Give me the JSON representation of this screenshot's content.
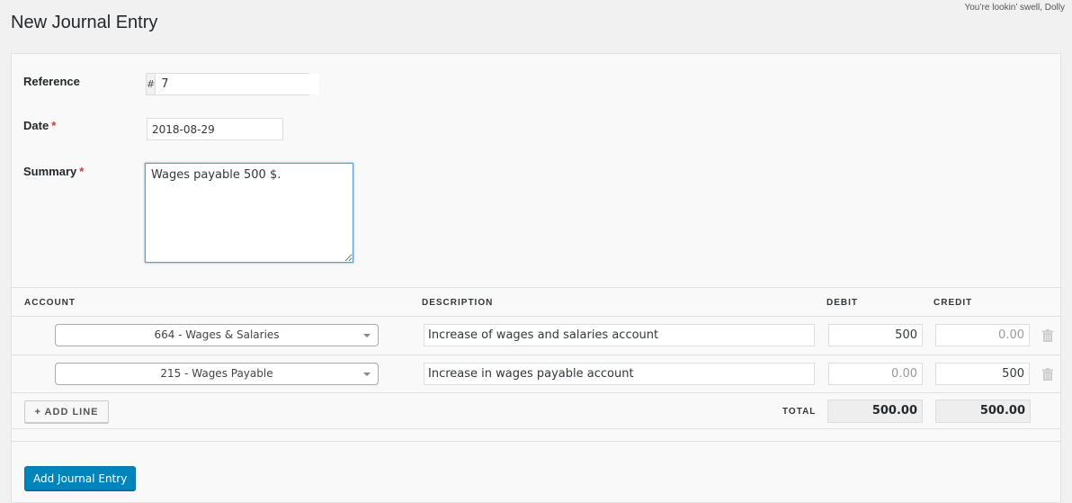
{
  "header": {
    "title": "New Journal Entry",
    "dolly_text": "You’re lookin’ swell, Dolly"
  },
  "form": {
    "reference": {
      "label": "Reference",
      "prefix": "#",
      "value": "7"
    },
    "date": {
      "label": "Date",
      "required_mark": "*",
      "value": "2018-08-29"
    },
    "summary": {
      "label": "Summary",
      "required_mark": "*",
      "value": "Wages payable 500 $."
    }
  },
  "table": {
    "headers": {
      "account": "ACCOUNT",
      "description": "DESCRIPTION",
      "debit": "DEBIT",
      "credit": "CREDIT"
    },
    "rows": [
      {
        "account": "664 - Wages & Salaries",
        "description": "Increase of wages and salaries account",
        "debit": "500",
        "credit": "",
        "debit_placeholder": "0.00",
        "credit_placeholder": "0.00"
      },
      {
        "account": "215 - Wages Payable",
        "description": "Increase in wages payable account",
        "debit": "",
        "credit": "500",
        "debit_placeholder": "0.00",
        "credit_placeholder": "0.00"
      }
    ],
    "add_line_label": "+ ADD LINE",
    "total_label": "TOTAL",
    "total_debit": "500.00",
    "total_credit": "500.00"
  },
  "actions": {
    "submit_label": "Add Journal Entry"
  },
  "colors": {
    "primary_button": "#0085ba",
    "required": "#dc3232",
    "focus_border": "#5b9dd9"
  },
  "icons": {
    "delete_row": "trash-icon",
    "select_arrow": "chevron-down-icon",
    "resize_handle": "resize-grip-icon"
  }
}
